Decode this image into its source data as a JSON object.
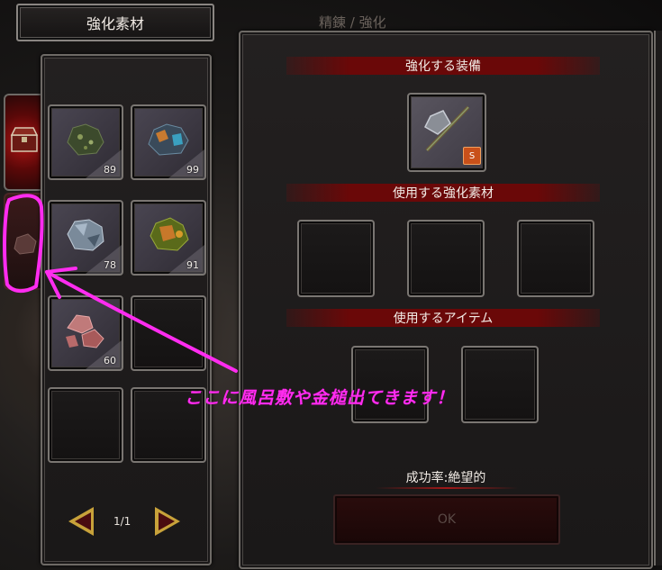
{
  "tabs": {
    "active_label": "強化素材",
    "inactive_label": "精錬 / 強化"
  },
  "materials": {
    "items": [
      {
        "icon": "dark-green-ore-icon",
        "quantity": "89"
      },
      {
        "icon": "blue-orange-ore-icon",
        "quantity": "99"
      },
      {
        "icon": "silver-ore-icon",
        "quantity": "78"
      },
      {
        "icon": "green-orange-ore-icon",
        "quantity": "91"
      },
      {
        "icon": "pink-ore-icon",
        "quantity": "60"
      }
    ],
    "page": "1/1"
  },
  "main": {
    "equip_header": "強化する装備",
    "equip_item": {
      "icon": "axe-icon",
      "badge": "S"
    },
    "material_header": "使用する強化素材",
    "item_header": "使用するアイテム",
    "success_rate": "成功率:絶望的",
    "ok_label": "OK"
  },
  "annotation": {
    "text": "ここに風呂敷や金槌出てきます！",
    "color": "#ff2cf0"
  },
  "colors": {
    "section_bar": "#6a0808",
    "arrow_gold": "#c8a23a",
    "active_tab_red": "#b01414"
  }
}
